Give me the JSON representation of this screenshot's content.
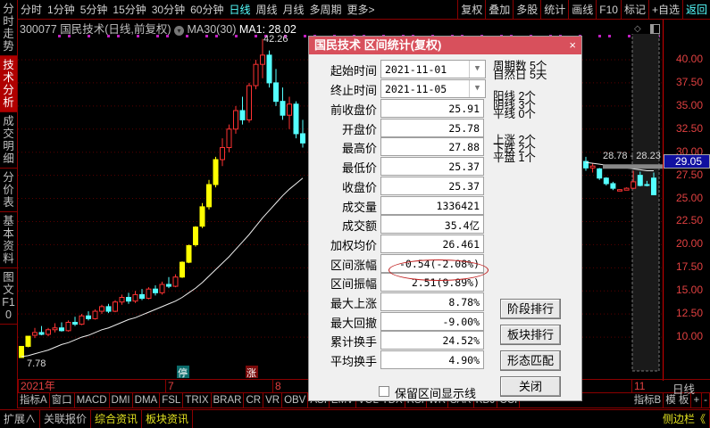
{
  "left_tabs": [
    {
      "label": "分时走势"
    },
    {
      "label": "技术分析",
      "active": true
    },
    {
      "label": "成交明细"
    },
    {
      "label": "分价表"
    },
    {
      "label": "基本资料"
    },
    {
      "label": "图文F10"
    }
  ],
  "top_menu": {
    "periods": [
      "分时",
      "1分钟",
      "5分钟",
      "15分钟",
      "30分钟",
      "60分钟",
      "日线",
      "周线",
      "月线",
      "多周期",
      "更多>"
    ],
    "active_period": "日线",
    "right": [
      "复权",
      "叠加",
      "多股",
      "统计",
      "画线",
      "F10",
      "标记",
      "+自选",
      "返回"
    ]
  },
  "info": {
    "code": "300077",
    "name": "国民技术",
    "mode": "(日线,前复权)",
    "indicator": "MA30(30)",
    "ma_label": "MA1: 28.02"
  },
  "chart_data": {
    "type": "candlestick",
    "yaxis": {
      "ticks": [
        "40.00",
        "37.50",
        "35.00",
        "32.50",
        "30.00",
        "27.50",
        "25.00",
        "22.50",
        "20.00",
        "17.50",
        "15.00",
        "12.50",
        "10.00"
      ],
      "range": [
        7.5,
        41.5
      ]
    },
    "current_price": "29.05",
    "high_label": "42.26",
    "low_label": "7.78",
    "range_label": "28.78 - 28.23",
    "date_labels": [
      "2021年",
      "7",
      "8",
      "11"
    ],
    "markers": [
      "停",
      "涨"
    ],
    "left_candles": [
      [
        7.8,
        9.0,
        7.78,
        9.0,
        "y"
      ],
      [
        9.0,
        10.1,
        8.9,
        10.1,
        "y"
      ],
      [
        10.2,
        11.0,
        9.9,
        10.5,
        "u"
      ],
      [
        10.5,
        11.2,
        10.2,
        10.3,
        "d"
      ],
      [
        10.3,
        11.0,
        10.1,
        10.8,
        "u"
      ],
      [
        10.8,
        11.5,
        10.5,
        11.0,
        "u"
      ],
      [
        11.0,
        11.6,
        10.6,
        10.7,
        "d"
      ],
      [
        10.7,
        11.8,
        10.6,
        11.6,
        "u"
      ],
      [
        11.6,
        12.2,
        11.2,
        11.4,
        "d"
      ],
      [
        11.4,
        12.5,
        11.3,
        12.3,
        "u"
      ],
      [
        12.3,
        12.8,
        11.8,
        12.0,
        "d"
      ],
      [
        12.0,
        13.0,
        11.9,
        12.8,
        "u"
      ],
      [
        12.8,
        13.5,
        12.5,
        13.3,
        "u"
      ],
      [
        13.3,
        13.6,
        12.6,
        12.8,
        "d"
      ],
      [
        12.8,
        14.0,
        12.7,
        13.8,
        "u"
      ],
      [
        13.8,
        14.6,
        13.5,
        14.3,
        "u"
      ],
      [
        14.3,
        14.8,
        13.6,
        13.9,
        "d"
      ],
      [
        13.9,
        15.0,
        13.7,
        14.6,
        "u"
      ],
      [
        14.6,
        15.2,
        14.0,
        14.2,
        "d"
      ],
      [
        14.2,
        15.4,
        14.1,
        15.2,
        "u"
      ],
      [
        15.2,
        15.6,
        14.5,
        14.8,
        "d"
      ],
      [
        14.8,
        16.0,
        14.6,
        15.7,
        "u"
      ],
      [
        15.7,
        16.5,
        15.3,
        15.5,
        "d"
      ],
      [
        15.5,
        16.8,
        15.4,
        16.5,
        "u"
      ],
      [
        16.5,
        18.2,
        16.4,
        18.1,
        "y"
      ],
      [
        18.1,
        20.0,
        18.0,
        19.9,
        "y"
      ],
      [
        20.0,
        22.0,
        19.8,
        21.9,
        "y"
      ],
      [
        22.0,
        24.5,
        21.8,
        24.1,
        "y"
      ],
      [
        24.1,
        27.0,
        23.8,
        26.5,
        "y"
      ],
      [
        26.5,
        29.5,
        26.2,
        29.2,
        "y"
      ],
      [
        29.2,
        31.5,
        28.5,
        30.5,
        "u"
      ],
      [
        30.5,
        33.0,
        30.0,
        32.5,
        "u"
      ],
      [
        32.5,
        35.0,
        32.0,
        34.5,
        "u"
      ],
      [
        34.5,
        36.0,
        33.0,
        33.5,
        "d"
      ],
      [
        33.5,
        37.5,
        33.2,
        37.2,
        "u"
      ],
      [
        37.2,
        40.0,
        36.8,
        39.5,
        "u"
      ],
      [
        39.5,
        42.26,
        38.0,
        40.5,
        "u"
      ],
      [
        40.5,
        41.0,
        37.0,
        37.5,
        "d"
      ],
      [
        37.5,
        39.0,
        35.0,
        35.5,
        "d"
      ],
      [
        35.5,
        37.0,
        33.5,
        34.0,
        "d"
      ],
      [
        34.0,
        36.0,
        32.5,
        35.2,
        "u"
      ],
      [
        35.2,
        35.5,
        31.5,
        32.0,
        "d"
      ],
      [
        32.0,
        33.5,
        30.5,
        31.0,
        "d"
      ]
    ],
    "right_candles": [
      [
        29.0,
        29.5,
        28.0,
        28.3,
        "d"
      ],
      [
        28.3,
        28.8,
        27.8,
        28.5,
        "u"
      ],
      [
        28.2,
        28.3,
        27.0,
        27.2,
        "d"
      ],
      [
        27.2,
        27.3,
        26.4,
        26.6,
        "d"
      ],
      [
        26.6,
        26.8,
        25.9,
        26.1,
        "d"
      ],
      [
        25.8,
        26.0,
        25.8,
        25.95,
        "u"
      ],
      [
        25.9,
        26.2,
        25.9,
        26.1,
        "u"
      ],
      [
        26.1,
        28.0,
        26.0,
        26.8,
        "u"
      ],
      [
        27.5,
        27.9,
        26.3,
        26.4,
        "d"
      ],
      [
        26.5,
        26.9,
        26.3,
        26.4,
        "d"
      ],
      [
        27.2,
        27.8,
        25.4,
        25.4,
        "d"
      ]
    ],
    "ma30_left": [
      7.9,
      8.0,
      8.2,
      8.4,
      8.6,
      8.9,
      9.2,
      9.4,
      9.7,
      10.0,
      10.2,
      10.5,
      10.8,
      11.0,
      11.3,
      11.6,
      11.9,
      12.1,
      12.4,
      12.7,
      13.0,
      13.3,
      13.6,
      13.9,
      14.3,
      14.8,
      15.3,
      15.9,
      16.6,
      17.3,
      18.0,
      18.7,
      19.5,
      20.3,
      21.1,
      22.0,
      22.9,
      23.7,
      24.5,
      25.3,
      26.0,
      26.6,
      27.2
    ],
    "ma30_right": [
      28.9,
      28.8,
      28.7,
      28.6,
      28.5,
      28.4,
      28.3,
      28.2,
      28.1,
      28.0,
      28.0
    ]
  },
  "dialog": {
    "title": "国民技术 区间统计(复权)",
    "close": "×",
    "start_label": "起始时间",
    "start": "2021-11-01",
    "end_label": "终止时间",
    "end": "2021-11-05",
    "rows": [
      {
        "label": "前收盘价",
        "value": "25.91"
      },
      {
        "label": "开盘价",
        "value": "25.78"
      },
      {
        "label": "最高价",
        "value": "27.88"
      },
      {
        "label": "最低价",
        "value": "25.37"
      },
      {
        "label": "收盘价",
        "value": "25.37"
      },
      {
        "label": "成交量",
        "value": "1336421"
      },
      {
        "label": "成交额",
        "value": "35.4亿"
      },
      {
        "label": "加权均价",
        "value": "26.461"
      },
      {
        "label": "区间涨幅",
        "value": "-0.54(-2.08%)"
      },
      {
        "label": "区间振幅",
        "value": "2.51(9.89%)"
      },
      {
        "label": "最大上涨",
        "value": "8.78%"
      },
      {
        "label": "最大回撤",
        "value": "-9.00%"
      },
      {
        "label": "累计换手",
        "value": "24.52%"
      },
      {
        "label": "平均换手",
        "value": "4.90%"
      }
    ],
    "stats": [
      "周期数 5个",
      "自然日 5天",
      "阳线 2个",
      "阴线 3个",
      "平线 0个",
      "上涨 2个",
      "下跌 2个",
      "平盘 1个"
    ],
    "buttons": [
      "阶段排行",
      "板块排行",
      "形态匹配",
      "关闭"
    ],
    "checkbox": "保留区间显示线"
  },
  "indicator_tabs": [
    "指标A",
    "窗口",
    "MACD",
    "DMI",
    "DMA",
    "FSL",
    "TRIX",
    "BRAR",
    "CR",
    "VR",
    "OBV",
    "ASI",
    "EMV",
    "VOL-TDX",
    "RSI",
    "WR",
    "SAR",
    "KDJ",
    "CCI",
    "指标B",
    "模 板",
    "+",
    "-"
  ],
  "bottom_tabs": [
    "扩展∧",
    "关联报价",
    "综合资讯",
    "板块资讯",
    "侧边栏《"
  ]
}
